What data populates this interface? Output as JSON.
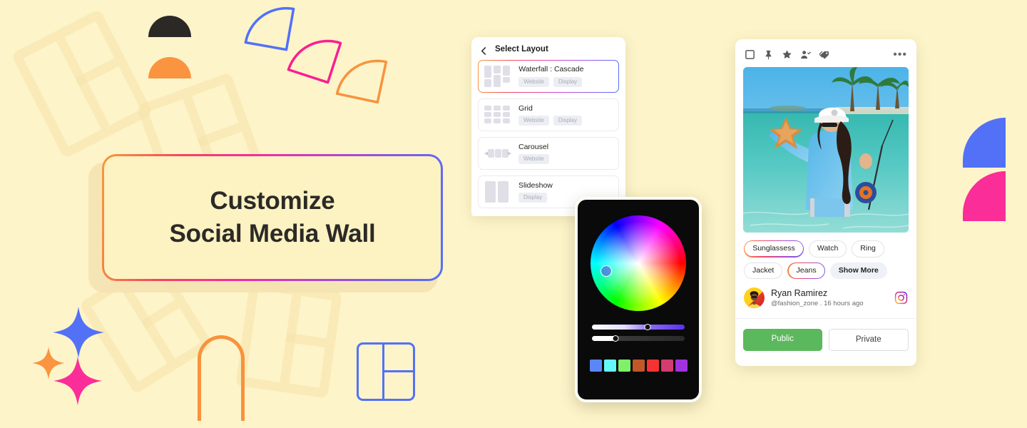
{
  "hero": {
    "line1": "Customize",
    "line2": "Social Media Wall"
  },
  "layout_panel": {
    "back_icon": "chevron-left-icon",
    "title": "Select Layout",
    "items": [
      {
        "name": "Waterfall : Cascade",
        "tags": [
          "Website",
          "Display"
        ],
        "selected": true,
        "thumb": "waterfall"
      },
      {
        "name": "Grid",
        "tags": [
          "Website",
          "Display"
        ],
        "selected": false,
        "thumb": "grid"
      },
      {
        "name": "Carousel",
        "tags": [
          "Website"
        ],
        "selected": false,
        "thumb": "carousel"
      },
      {
        "name": "Slideshow",
        "tags": [
          "Display"
        ],
        "selected": false,
        "thumb": "slideshow"
      }
    ]
  },
  "color_picker": {
    "hue_slider_value": 60,
    "alpha_slider_value": 25,
    "cursor_color": "#5a3ce6",
    "swatches": [
      "#5b86f5",
      "#63f7f7",
      "#7ef06a",
      "#c2572a",
      "#f53333",
      "#d33c6e",
      "#a033dd"
    ]
  },
  "social_card": {
    "toolbar": {
      "icons": [
        "checkbox-icon",
        "pin-icon",
        "star-icon",
        "person-check-icon",
        "tag-icon"
      ],
      "more": "•••"
    },
    "photo_alt": "Woman holding starfish in shallow turquoise water with palm trees",
    "tags": [
      {
        "label": "Sunglassess",
        "style": "gradient"
      },
      {
        "label": "Watch",
        "style": "plain"
      },
      {
        "label": "Ring",
        "style": "plain"
      },
      {
        "label": "Jacket",
        "style": "plain"
      },
      {
        "label": "Jeans",
        "style": "gradient"
      },
      {
        "label": "Show More",
        "style": "filled"
      }
    ],
    "author": {
      "name": "Ryan Ramirez",
      "meta": "@fashion_zone . 16 hours ago",
      "network_icon": "instagram-icon"
    },
    "visibility": {
      "public_label": "Public",
      "private_label": "Private",
      "active": "Public",
      "public_color": "#5cb85c"
    }
  },
  "theme": {
    "background": "#fdf4c9",
    "gradient_border": "#f79a3e → #fa29a0 → #5271f7",
    "decor_colors": {
      "dark": "#2b2926",
      "orange": "#fb9440",
      "blue": "#5271f7",
      "pink": "#fb2d98"
    }
  }
}
